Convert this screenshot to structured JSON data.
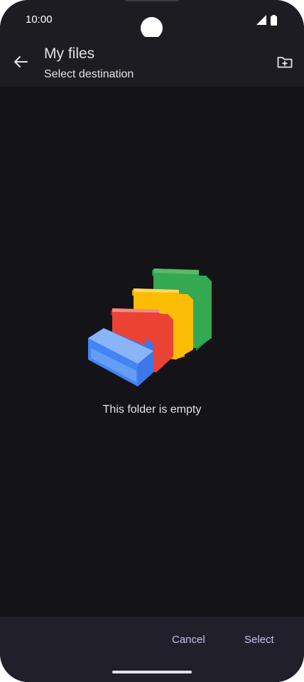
{
  "status_bar": {
    "time": "10:00",
    "icons": [
      "signal-icon",
      "battery-icon"
    ]
  },
  "app_bar": {
    "title": "My files",
    "subtitle": "Select destination",
    "back_icon": "arrow-back-icon",
    "new_folder_icon": "create-new-folder-icon"
  },
  "content": {
    "empty_message": "This folder is empty",
    "illustration": "empty-folders-illustration",
    "folder_colors": [
      "#4285f4",
      "#ea4335",
      "#fbbc04",
      "#34a853"
    ]
  },
  "bottom_bar": {
    "cancel_label": "Cancel",
    "select_label": "Select"
  },
  "colors": {
    "background": "#141318",
    "bar_background": "#1d1c22",
    "bottom_background": "#211f29",
    "accent_text": "#c8c2ec"
  }
}
